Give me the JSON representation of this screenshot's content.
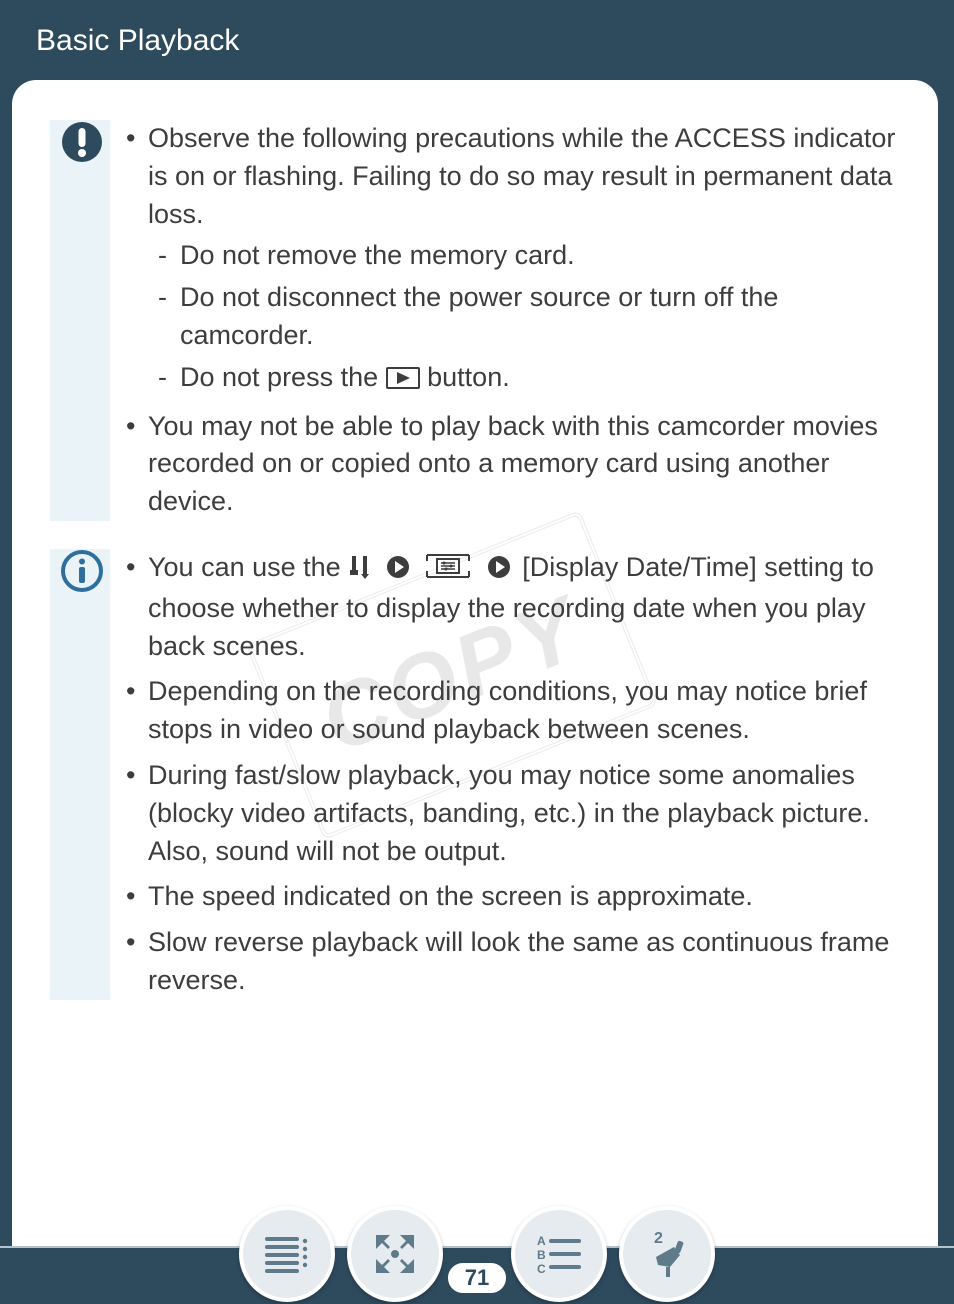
{
  "header": {
    "title": "Basic Playback"
  },
  "watermark": "COPY",
  "caution": {
    "items": [
      {
        "text": "Observe the following precautions while the ACCESS indicator is on or flashing. Failing to do so may result in permanent data loss.",
        "sub": [
          "Do not remove the memory card.",
          "Do not disconnect the power source or turn off the camcorder.",
          "Do not press the  button."
        ],
        "sub2_prefix": "Do not press the ",
        "sub2_suffix": " button."
      },
      {
        "text": "You may not be able to play back with this camcorder movies recorded on or copied onto a memory card using another device."
      }
    ]
  },
  "info": {
    "items": [
      {
        "prefix": "You can use the ",
        "middle": " [Display Date/Time] setting to choose whether to display the recording date when you play back scenes."
      },
      {
        "text": "Depending on the recording conditions, you may notice brief stops in video or sound playback between scenes."
      },
      {
        "text": "During fast/slow playback, you may notice some anomalies (blocky video artifacts, banding, etc.) in the playback picture. Also, sound will not be output."
      },
      {
        "text": "The speed indicated on the screen is approximate."
      },
      {
        "text": "Slow reverse playback will look the same as continuous frame reverse."
      }
    ]
  },
  "footer": {
    "page_number": "71"
  }
}
